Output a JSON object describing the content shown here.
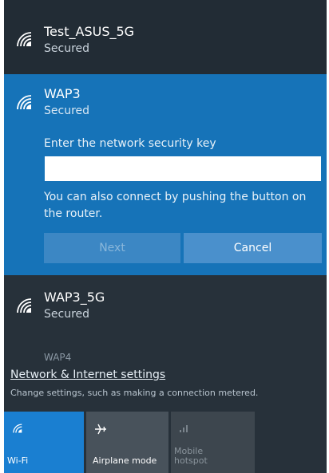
{
  "networks": [
    {
      "ssid": "Test_ASUS_5G",
      "status": "Secured"
    },
    {
      "ssid": "WAP3",
      "status": "Secured"
    },
    {
      "ssid": "WAP3_5G",
      "status": "Secured"
    },
    {
      "ssid": "WAP4"
    }
  ],
  "connect_panel": {
    "prompt": "Enter the network security key",
    "key_value": "",
    "wps_hint": "You can also connect by pushing the button on the router.",
    "next_label": "Next",
    "cancel_label": "Cancel"
  },
  "settings": {
    "link": "Network & Internet settings",
    "description": "Change settings, such as making a connection metered."
  },
  "quick_actions": [
    {
      "label": "Wi-Fi",
      "icon": "wifi-icon",
      "state": "on"
    },
    {
      "label": "Airplane mode",
      "icon": "airplane-icon",
      "state": "off"
    },
    {
      "label": "Mobile hotspot",
      "label_line1": "Mobile",
      "label_line2": "hotspot",
      "icon": "hotspot-icon",
      "state": "disabled"
    }
  ],
  "colors": {
    "flyout_bg": "#27313a",
    "selected_bg": "#1673b8",
    "accent": "#1a7fd1"
  }
}
